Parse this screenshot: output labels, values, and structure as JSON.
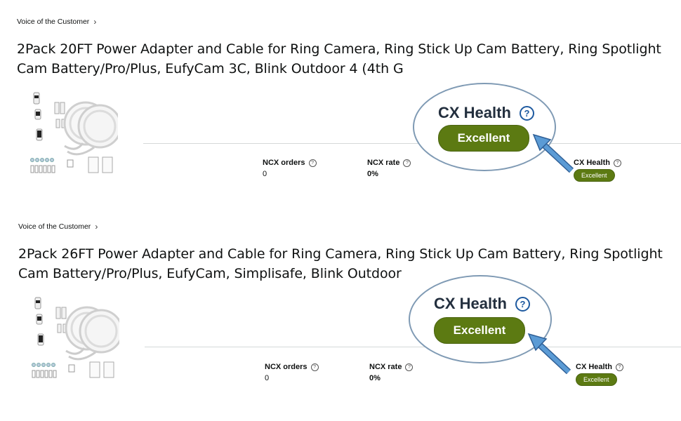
{
  "sections": [
    {
      "breadcrumb": "Voice of the Customer",
      "title": "2Pack 20FT Power Adapter and Cable for Ring Camera, Ring Stick Up Cam Battery, Ring Spotlight Cam Battery/Pro/Plus, EufyCam 3C, Blink Outdoor 4 (4th G",
      "metrics": {
        "ncx_orders_label": "NCX orders",
        "ncx_orders_value": "0",
        "ncx_rate_label": "NCX rate",
        "ncx_rate_value": "0%",
        "cx_health_label": "CX Health",
        "cx_health_value": "Excellent"
      },
      "callout": {
        "title": "CX Health",
        "badge": "Excellent"
      }
    },
    {
      "breadcrumb": "Voice of the Customer",
      "title": "2Pack 26FT Power Adapter and Cable for Ring Camera, Ring Stick Up Cam Battery, Ring Spotlight Cam Battery/Pro/Plus, EufyCam, Simplisafe, Blink Outdoor",
      "metrics": {
        "ncx_orders_label": "NCX orders",
        "ncx_orders_value": "0",
        "ncx_rate_label": "NCX rate",
        "ncx_rate_value": "0%",
        "cx_health_label": "CX Health",
        "cx_health_value": "Excellent"
      },
      "callout": {
        "title": "CX Health",
        "badge": "Excellent"
      }
    }
  ],
  "colors": {
    "health_green": "#5c7a12",
    "callout_border": "#7f9ab4",
    "arrow_blue": "#4a86c5"
  },
  "icons": [
    "chevron-right-icon",
    "help-circle-icon",
    "product-thumbnail",
    "pointer-arrow"
  ]
}
